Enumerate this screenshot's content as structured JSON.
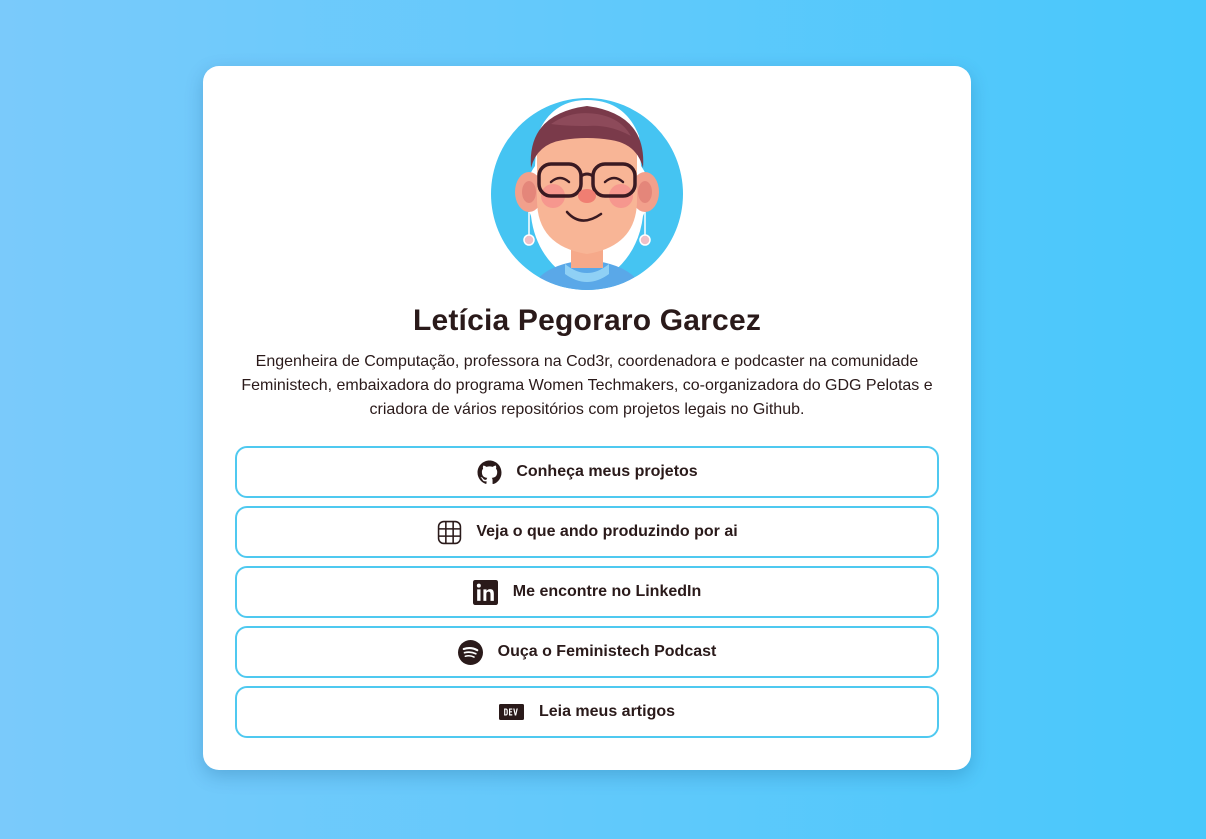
{
  "profile": {
    "name": "Letícia Pegoraro Garcez",
    "bio": "Engenheira de Computação, professora na Cod3r, coordenadora e podcaster na comunidade Feministech, embaixadora do programa Women Techmakers, co-organizadora do GDG Pelotas e criadora de vários repositórios com projetos legais no Github."
  },
  "links": [
    {
      "label": "Conheça meus projetos",
      "icon": "github-icon"
    },
    {
      "label": "Veja o que ando produzindo por ai",
      "icon": "grid-icon"
    },
    {
      "label": "Me encontre no LinkedIn",
      "icon": "linkedin-icon"
    },
    {
      "label": "Ouça o Feministech Podcast",
      "icon": "spotify-icon"
    },
    {
      "label": "Leia meus artigos",
      "icon": "dev-icon"
    }
  ],
  "colors": {
    "background_start": "#7acafb",
    "background_end": "#48c8fb",
    "card": "#ffffff",
    "button_border": "#4fc9f0",
    "text": "#2a1a1a"
  }
}
